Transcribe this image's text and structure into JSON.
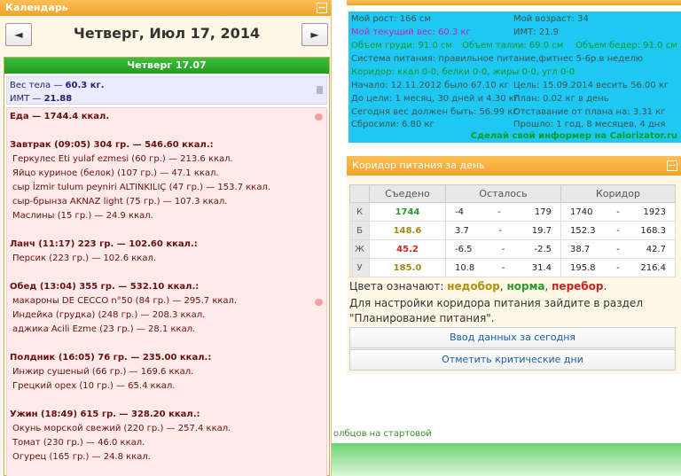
{
  "calendar": {
    "title": "Календарь",
    "minimize": "−",
    "prev": "◄",
    "next": "►",
    "date_title": "Четверг, Июл 17, 2014",
    "day_title": "Четверг 17.07"
  },
  "weight": {
    "line1_label": "Вес тела — ",
    "line1_value": "60.3 кг.",
    "line2_label": "ИМТ — ",
    "line2_value": "21.88"
  },
  "food": {
    "total": "Еда — 1744.4 ккал.",
    "meals": [
      {
        "title": "Завтрак (09:05) 304 гр. — 546.60 ккал.:",
        "items": [
          "Геркулес Eti yulaf ezmesi (60 гр.) — 213.6 ккал.",
          "Яйцо куриное (белок) (107 гр.) — 47.1 ккал.",
          "сыр İzmir tulum peyniri ALTINKILIÇ (47 гр.) — 153.7 ккал.",
          "сыр-брынза AKNAZ light (75 гр.) — 107.3 ккал.",
          "Маслины (15 гр.) — 24.9 ккал."
        ]
      },
      {
        "title": "Ланч (11:17) 223 гр. — 102.60 ккал.:",
        "items": [
          "Персик (223 гр.) — 102.6 ккал."
        ]
      },
      {
        "title": "Обед (13:04) 355 гр. — 532.10 ккал.:",
        "items": [
          "макароны DE CECCO n°50 (84 гр.) — 295.7 ккал.",
          "Индейка (грудка) (248 гр.) — 208.3 ккал.",
          "аджика Acili Ezme (23 гр.) — 28.1 ккал."
        ]
      },
      {
        "title": "Полдник (16:05) 76 гр. — 235.00 ккал.:",
        "items": [
          "Инжир сушеный (66 гр.) — 169.6 ккал.",
          "Грецкий орех (10 гр.) — 65.4 ккал."
        ]
      },
      {
        "title": "Ужин (18:49) 615 гр. — 328.20 ккал.:",
        "items": [
          "Окунь морской свежий (220 гр.) — 257.4 ккал.",
          "Томат (230 гр.) — 46.0 ккал.",
          "Огурец (165 гр.) — 24.8 ккал."
        ]
      }
    ]
  },
  "profile": {
    "height": "Мой рост: 166 см",
    "age": "Мой возраст: 34",
    "cur_weight": "Мой текущий вес: 60.3 кг",
    "bmi": "ИМТ: 21.9",
    "chest": "Объем груди: 91.0 см",
    "waist": "Объем талии: 69.0 см",
    "hips": "Объем бедер: 91.0 см",
    "system": "Система питания: правильное питание,фитнес 5-6р.в неделю",
    "corridor": "Коридор: ккал 0-0, белки 0-0, жиры 0-0, угл 0-0",
    "start": "Начало: 12.11.2012 было 67.10 кг",
    "goal": "Цель: 15.09.2014 весить 56.00 кг",
    "to_goal": "До цели: 1 месяц, 30 дней и 4.30 кг",
    "plan": "План: 0.02 кг в день",
    "today_should": "Сегодня вес должен быть: 56.99 кг",
    "behind": "Отставание от плана на: 3.31 кг",
    "lost": "Сбросили: 6.80 кг",
    "passed": "Прошло: 1 год, 8 месяцев, 4 дня",
    "make_informer": "Сделай свой информер на Calorizator.ru"
  },
  "corridor_panel": {
    "title": "Коридор питания за день",
    "minimize": "−",
    "headers": [
      "Съедено",
      "Осталось",
      "Коридор"
    ],
    "rows": [
      {
        "label": "К",
        "eaten": "1744",
        "eaten_class": "g",
        "left_from": "-4",
        "left_to": "179",
        "cor_from": "1740",
        "cor_to": "1923"
      },
      {
        "label": "Б",
        "eaten": "148.6",
        "eaten_class": "y",
        "left_from": "3.7",
        "left_to": "19.7",
        "cor_from": "152.3",
        "cor_to": "168.3"
      },
      {
        "label": "Ж",
        "eaten": "45.2",
        "eaten_class": "r",
        "left_from": "-6.5",
        "left_to": "-2.5",
        "cor_from": "38.7",
        "cor_to": "42.7"
      },
      {
        "label": "У",
        "eaten": "185.0",
        "eaten_class": "y",
        "left_from": "10.8",
        "left_to": "31.4",
        "cor_from": "195.8",
        "cor_to": "216.4"
      }
    ],
    "dash": "-",
    "legend_prefix": "Цвета означают: ",
    "legend_under": "недобор",
    "legend_norm": "норма",
    "legend_over": "перебор",
    "sep": ", ",
    "end": ".",
    "note": "Для настройки коридора питания зайдите в раздел \"Планирование питания\".",
    "btn_today": "Ввод данных за сегодня",
    "btn_crit": "Отметить критические дни"
  },
  "bottom": {
    "text": "олбцов на стартовой"
  },
  "colors": {
    "orange": "#f2a32a",
    "green": "#229a22",
    "cyan": "#1ec8f2",
    "link": "#1a5da8"
  }
}
